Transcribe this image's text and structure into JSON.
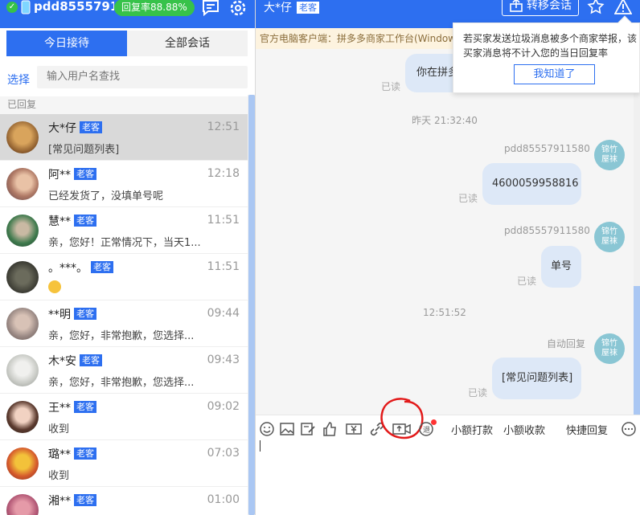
{
  "left_header": {
    "shop_name": "pdd8555791...",
    "rate_badge": "回复率88.88%"
  },
  "tabs": [
    {
      "label": "今日接待",
      "active": true
    },
    {
      "label": "全部会话",
      "active": false
    }
  ],
  "search": {
    "select_label": "选择",
    "placeholder": "输入用户名查找"
  },
  "section_label": "已回复",
  "conversations": [
    {
      "name": "大*仔",
      "tag": "老客",
      "time": "12:51",
      "message": "[常见问题列表]",
      "selected": true
    },
    {
      "name": "阿**",
      "tag": "老客",
      "time": "12:18",
      "message": "已经发货了，没填单号呢"
    },
    {
      "name": "慧**",
      "tag": "老客",
      "time": "11:51",
      "message": "亲，您好！正常情况下，当天1..."
    },
    {
      "name": "。***。",
      "tag": "老客",
      "time": "11:51",
      "message": ""
    },
    {
      "name": "**明",
      "tag": "老客",
      "time": "09:44",
      "message": "亲，您好，非常抱歉，您选择..."
    },
    {
      "name": "木*安",
      "tag": "老客",
      "time": "09:43",
      "message": "亲，您好，非常抱歉，您选择..."
    },
    {
      "name": "王**",
      "tag": "老客",
      "time": "09:02",
      "message": "收到"
    },
    {
      "name": "璐**",
      "tag": "老客",
      "time": "07:03",
      "message": "收到"
    },
    {
      "name": "湘**",
      "tag": "老客",
      "time": "01:00",
      "message": ""
    }
  ],
  "chat_header": {
    "title": "大*仔",
    "tag": "老客",
    "transfer_label": "转移会话"
  },
  "notice": "官方电脑客户端：拼多多商家工作台(Windows",
  "tooltip": {
    "text": "若买家发送垃圾消息被多个商家举报，该买家消息将不计入您的当日回复率",
    "button": "我知道了"
  },
  "messages": {
    "m0_text": "你在拼多",
    "m0_read": "已读",
    "ts1": "昨天 21:32:40",
    "m1_sender": "pdd85557911580",
    "m1_text": "4600059958816",
    "m1_read": "已读",
    "m2_sender": "pdd85557911580",
    "m2_text": "单号",
    "m2_read": "已读",
    "ts2": "12:51:52",
    "m3_sender": "自动回复",
    "m3_text": "[常见问题列表]",
    "m3_read": "已读",
    "seller_avatar_line1": "锦竹",
    "seller_avatar_line2": "屋袜"
  },
  "toolbar": {
    "small_pay": "小额打款",
    "small_collect": "小额收款",
    "quick_reply": "快捷回复"
  },
  "colors": {
    "brand_blue": "#2d6ff0",
    "badge_green": "#37c24a",
    "bubble": "#dde8f7"
  }
}
